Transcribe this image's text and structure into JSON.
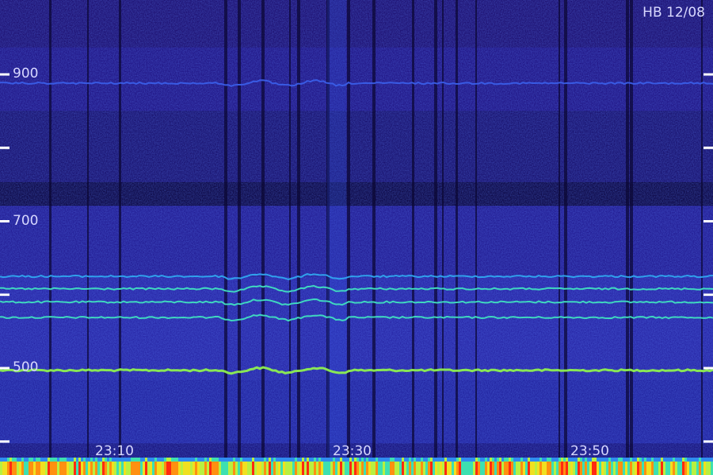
{
  "chart_data": {
    "type": "heatmap",
    "title": "HB 12/08",
    "xlabel": "",
    "ylabel": "",
    "x_tick_labels": [
      "23:10",
      "23:30",
      "23:50"
    ],
    "y_tick_labels": [
      "900",
      "700",
      "500"
    ],
    "y_minor_ticks": [
      900,
      800,
      700,
      600,
      500,
      400
    ],
    "ylim": [
      350,
      1000
    ],
    "xlim_minutes": [
      0,
      60
    ],
    "x_tick_minutes": [
      15,
      35,
      55
    ],
    "traces": [
      {
        "name": "",
        "y": 497,
        "intensity": 0.95
      },
      {
        "name": "",
        "y": 569,
        "intensity": 0.7
      },
      {
        "name": "",
        "y": 590,
        "intensity": 0.8
      },
      {
        "name": "",
        "y": 608,
        "intensity": 0.6
      },
      {
        "name": "",
        "y": 625,
        "intensity": 0.45
      },
      {
        "name": "",
        "y": 888,
        "intensity": 0.25
      }
    ],
    "colormap": [
      "#000000",
      "#1a0a6e",
      "#2a3cc8",
      "#2f8cf0",
      "#3de0b0",
      "#b8f040",
      "#f0e020",
      "#ff9010",
      "#ff2a10"
    ],
    "grid": false
  }
}
